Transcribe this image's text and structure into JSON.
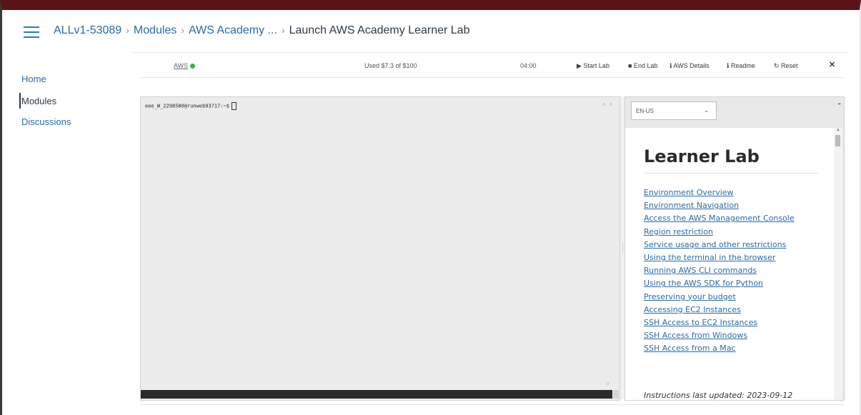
{
  "breadcrumbs": {
    "course": "ALLv1-53089",
    "modules": "Modules",
    "academy": "AWS Academy ...",
    "current": "Launch AWS Academy Learner Lab",
    "separator": "›"
  },
  "sidebar": {
    "items": [
      {
        "label": "Home"
      },
      {
        "label": "Modules"
      },
      {
        "label": "Discussions"
      }
    ]
  },
  "lab_toolbar": {
    "aws_label": "AWS",
    "aws_status_color": "#3bb34a",
    "used": "Used $7.3 of $100",
    "timer": "04:00",
    "start_lab": "▶ Start Lab",
    "end_lab": "■ End Lab",
    "aws_details": "ℹ AWS Details",
    "readme": "ℹ Readme",
    "reset": "↻ Reset",
    "fullscreen": "✕"
  },
  "terminal": {
    "prompt": "eee_W_2298580@runweb93717:~$"
  },
  "readme_panel": {
    "language": "EN-US",
    "title": "Learner Lab",
    "links": [
      "Environment Overview",
      "Environment Navigation",
      "Access the AWS Management Console",
      "Region restriction",
      "Service usage and other restrictions",
      "Using the terminal in the browser",
      "Running AWS CLI commands",
      "Using the AWS SDK for Python",
      "Preserving your budget",
      "Accessing EC2 Instances",
      "SSH Access to EC2 Instances",
      "SSH Access from Windows",
      "SSH Access from a Mac"
    ],
    "updated": "Instructions last updated: 2023-09-12"
  },
  "colors": {
    "link": "#2d6aa6",
    "top_border": "#5a1418"
  }
}
